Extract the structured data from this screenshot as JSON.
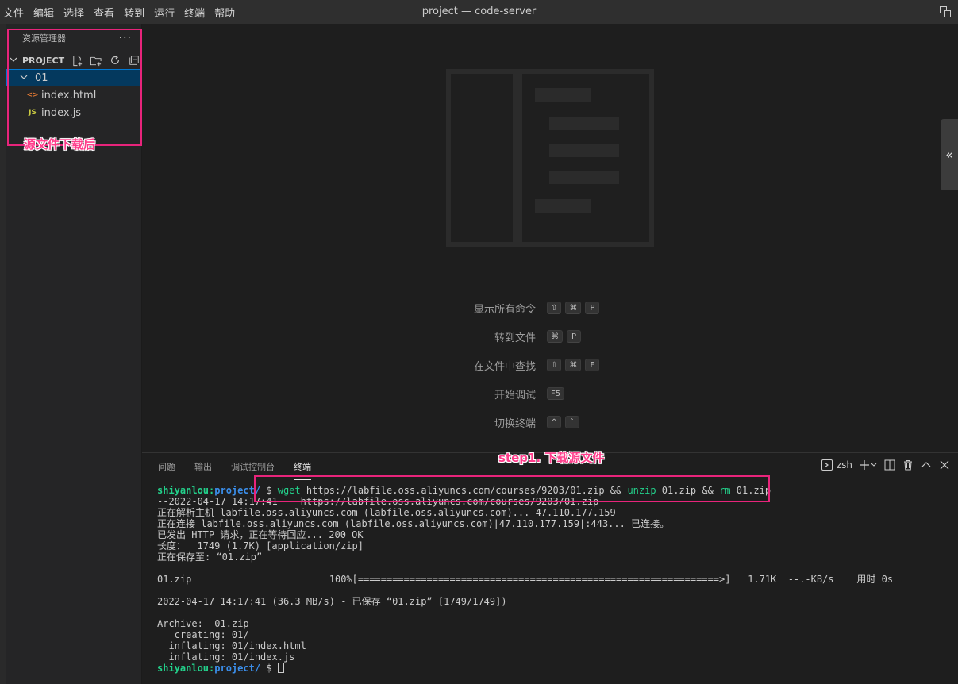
{
  "menu": [
    "文件",
    "编辑",
    "选择",
    "查看",
    "转到",
    "运行",
    "终端",
    "帮助"
  ],
  "window_title": "project — code-server",
  "explorer": {
    "title": "资源管理器",
    "more": "···",
    "section": "PROJECT",
    "folder": "01",
    "files": [
      {
        "name": "index.html",
        "icon": "<>"
      },
      {
        "name": "index.js",
        "icon": "JS"
      }
    ]
  },
  "welcome": {
    "shortcuts": [
      {
        "label": "显示所有命令",
        "keys": [
          "⇧",
          "⌘",
          "P"
        ]
      },
      {
        "label": "转到文件",
        "keys": [
          "⌘",
          "P"
        ]
      },
      {
        "label": "在文件中查找",
        "keys": [
          "⇧",
          "⌘",
          "F"
        ]
      },
      {
        "label": "开始调试",
        "keys": [
          "F5"
        ]
      },
      {
        "label": "切换终端",
        "keys": [
          "^",
          "`"
        ]
      }
    ],
    "collapse": "«"
  },
  "panel": {
    "tabs": [
      "问题",
      "输出",
      "调试控制台",
      "终端"
    ],
    "active_tab": "终端",
    "shell": "zsh"
  },
  "terminal": {
    "prompt_user": "shiyanlou:",
    "prompt_path": "project/",
    "prompt_symbol": " $ ",
    "cmd_parts": [
      "wget",
      " https://labfile.oss.aliyuncs.com/courses/9203/01.zip && ",
      "unzip",
      " 01.zip && ",
      "rm",
      " 01.zip"
    ],
    "lines": [
      "--2022-04-17 14:17:41--  https://labfile.oss.aliyuncs.com/courses/9203/01.zip",
      "正在解析主机 labfile.oss.aliyuncs.com (labfile.oss.aliyuncs.com)... 47.110.177.159",
      "正在连接 labfile.oss.aliyuncs.com (labfile.oss.aliyuncs.com)|47.110.177.159|:443... 已连接。",
      "已发出 HTTP 请求，正在等待回应... 200 OK",
      "长度：  1749 (1.7K) [application/zip]",
      "正在保存至: “01.zip”",
      "",
      "01.zip                        100%[===============================================================>]   1.71K  --.-KB/s    用时 0s",
      "",
      "2022-04-17 14:17:41 (36.3 MB/s) - 已保存 “01.zip” [1749/1749])",
      "",
      "Archive:  01.zip",
      "   creating: 01/",
      "  inflating: 01/index.html",
      "  inflating: 01/index.js"
    ]
  },
  "annotations": {
    "sidebar_note": "源文件下载后",
    "step_note": "step1. 下载源文件"
  },
  "colors": {
    "annotation": "#e8247b",
    "prompt_user": "#23d18b",
    "prompt_path": "#3b8eea"
  }
}
